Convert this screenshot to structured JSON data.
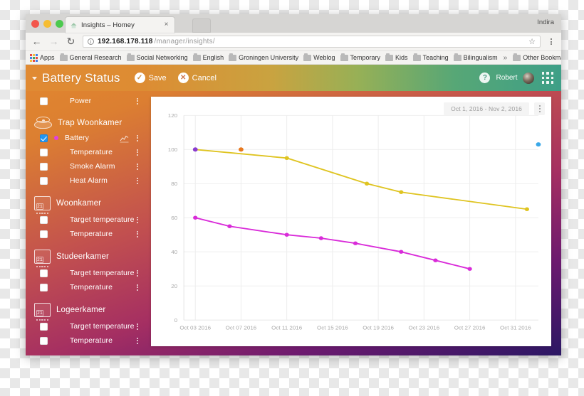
{
  "browser": {
    "profile_name": "Indira",
    "tab": {
      "title": "Insights – Homey",
      "close_label": "×",
      "favicon": "homey-favicon"
    },
    "nav": {
      "back": "←",
      "forward": "→",
      "reload": "↻",
      "info": "i",
      "star": "☆",
      "menu": "browser-menu"
    },
    "url": {
      "host": "192.168.178.118",
      "path": "/manager/insights/"
    },
    "bookmarks": [
      {
        "label": "Apps",
        "icon": "apps-grid-icon"
      },
      {
        "label": "General Research",
        "icon": "folder-icon"
      },
      {
        "label": "Social Networking",
        "icon": "folder-icon"
      },
      {
        "label": "English",
        "icon": "folder-icon"
      },
      {
        "label": "Groningen University",
        "icon": "folder-icon"
      },
      {
        "label": "Weblog",
        "icon": "folder-icon"
      },
      {
        "label": "Temporary",
        "icon": "folder-icon"
      },
      {
        "label": "Kids",
        "icon": "folder-icon"
      },
      {
        "label": "Teaching",
        "icon": "folder-icon"
      },
      {
        "label": "Bilingualism",
        "icon": "folder-icon"
      }
    ],
    "bookmarks_overflow": "»",
    "other_bookmarks": {
      "label": "Other Bookmarks",
      "icon": "folder-icon"
    }
  },
  "app": {
    "title": "Battery Status",
    "collapse_icon": "triangle-down-icon",
    "save_label": "Save",
    "cancel_label": "Cancel",
    "save_icon": "check-circle-icon",
    "cancel_icon": "x-circle-icon",
    "help_label": "?",
    "user_name": "Robert",
    "avatar": "user-avatar",
    "app_grid_icon": "app-grid-icon"
  },
  "sidebar": {
    "groups": [
      {
        "name": "",
        "icon": "",
        "items": [
          {
            "label": "Power",
            "checked": false,
            "color": null,
            "has_chart_icon": false
          }
        ]
      },
      {
        "name": "Trap Woonkamer",
        "icon": "smoke-detector-icon",
        "items": [
          {
            "label": "Battery",
            "checked": true,
            "color": "#e040e0",
            "has_chart_icon": true
          },
          {
            "label": "Temperature",
            "checked": false,
            "color": null,
            "has_chart_icon": false
          },
          {
            "label": "Smoke Alarm",
            "checked": false,
            "color": null,
            "has_chart_icon": false
          },
          {
            "label": "Heat Alarm",
            "checked": false,
            "color": null,
            "has_chart_icon": false
          }
        ]
      },
      {
        "name": "Woonkamer",
        "icon": "thermostat-icon",
        "icon_value": "21",
        "items": [
          {
            "label": "Target temperature",
            "checked": false,
            "color": null,
            "has_chart_icon": false
          },
          {
            "label": "Temperature",
            "checked": false,
            "color": null,
            "has_chart_icon": false
          }
        ]
      },
      {
        "name": "Studeerkamer",
        "icon": "thermostat-icon",
        "icon_value": "21",
        "items": [
          {
            "label": "Target temperature",
            "checked": false,
            "color": null,
            "has_chart_icon": false
          },
          {
            "label": "Temperature",
            "checked": false,
            "color": null,
            "has_chart_icon": false
          }
        ]
      },
      {
        "name": "Logeerkamer",
        "icon": "thermostat-icon",
        "icon_value": "21",
        "items": [
          {
            "label": "Target temperature",
            "checked": false,
            "color": null,
            "has_chart_icon": false
          },
          {
            "label": "Temperature",
            "checked": false,
            "color": null,
            "has_chart_icon": false
          }
        ]
      }
    ]
  },
  "chart_card": {
    "date_range": "Oct 1, 2016 - Nov 2, 2016",
    "menu_icon": "vertical-dots-icon"
  },
  "chart_data": {
    "type": "line",
    "title": "",
    "xlabel": "",
    "ylabel": "",
    "ylim": [
      0,
      120
    ],
    "yticks": [
      0,
      20,
      40,
      60,
      80,
      100,
      120
    ],
    "xticks": [
      "Oct 03 2016",
      "Oct 07 2016",
      "Oct 11 2016",
      "Oct 15 2016",
      "Oct 19 2016",
      "Oct 23 2016",
      "Oct 27 2016",
      "Oct 31 2016"
    ],
    "xlim": [
      "Oct 02 2016",
      "Nov 02 2016"
    ],
    "grid": true,
    "legend": "none",
    "series": [
      {
        "name": "Battery (yellow device)",
        "color": "#dfc421",
        "x": [
          "Oct 03 2016",
          "Oct 11 2016",
          "Oct 18 2016",
          "Oct 21 2016",
          "Nov 01 2016"
        ],
        "values": [
          100,
          95,
          80,
          75,
          65
        ]
      },
      {
        "name": "Battery (magenta device)",
        "color": "#d92bd9",
        "x": [
          "Oct 03 2016",
          "Oct 06 2016",
          "Oct 11 2016",
          "Oct 14 2016",
          "Oct 17 2016",
          "Oct 21 2016",
          "Oct 24 2016",
          "Oct 27 2016"
        ],
        "values": [
          60,
          55,
          50,
          48,
          45,
          40,
          35,
          30
        ]
      }
    ],
    "markers": [
      {
        "name": "orange-point",
        "color": "#e8791f",
        "x": "Oct 07 2016",
        "value": 100
      },
      {
        "name": "blue-point",
        "color": "#3aa8e8",
        "x": "Nov 02 2016",
        "value": 103
      },
      {
        "name": "violet-point",
        "color": "#8a3ccf",
        "x": "Oct 03 2016",
        "value": 100
      }
    ]
  }
}
